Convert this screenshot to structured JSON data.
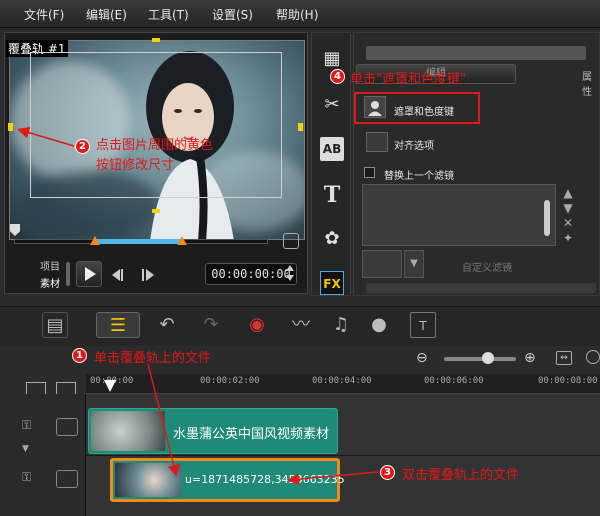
{
  "menu": [
    "文件(F)",
    "编辑(E)",
    "工具(T)",
    "设置(S)",
    "帮助(H)"
  ],
  "preview": {
    "track_label": "覆叠轨 #1",
    "project_label": "项目",
    "clip_label": "素材",
    "timecode": "00:00:00:00"
  },
  "options": {
    "top_button": "编辑",
    "right_tab": "属性",
    "mask_chroma": "遮罩和色度键",
    "align_options": "对齐选项",
    "replace_filter": "替换上一个滤镜",
    "custom_filter": "自定义滤镜",
    "fx_label": "FX"
  },
  "timeline": {
    "ticks": [
      "00:00:00",
      "00:00:02:00",
      "00:00:04:00",
      "00:00:06:00",
      "00:00:08:00"
    ],
    "clip1_text": "水墨蒲公英中国风视频素材",
    "clip2_text": "u=1871485728,3453663235"
  },
  "annotations": {
    "a1_num": "1",
    "a1_text": "单击覆叠轨上的文件",
    "a2_num": "2",
    "a2_line1": "点击图片周围的黄色",
    "a2_line2": "按钮修改尺寸",
    "a3_num": "3",
    "a3_text": "双击覆叠轨上的文件",
    "a4_num": "4",
    "a4_text": "单击\"遮罩和色度键\""
  },
  "colors": {
    "accent": "#e01818",
    "handle": "#f3d400",
    "clip": "#1f8a78",
    "clip_selected": "#f08a18"
  }
}
